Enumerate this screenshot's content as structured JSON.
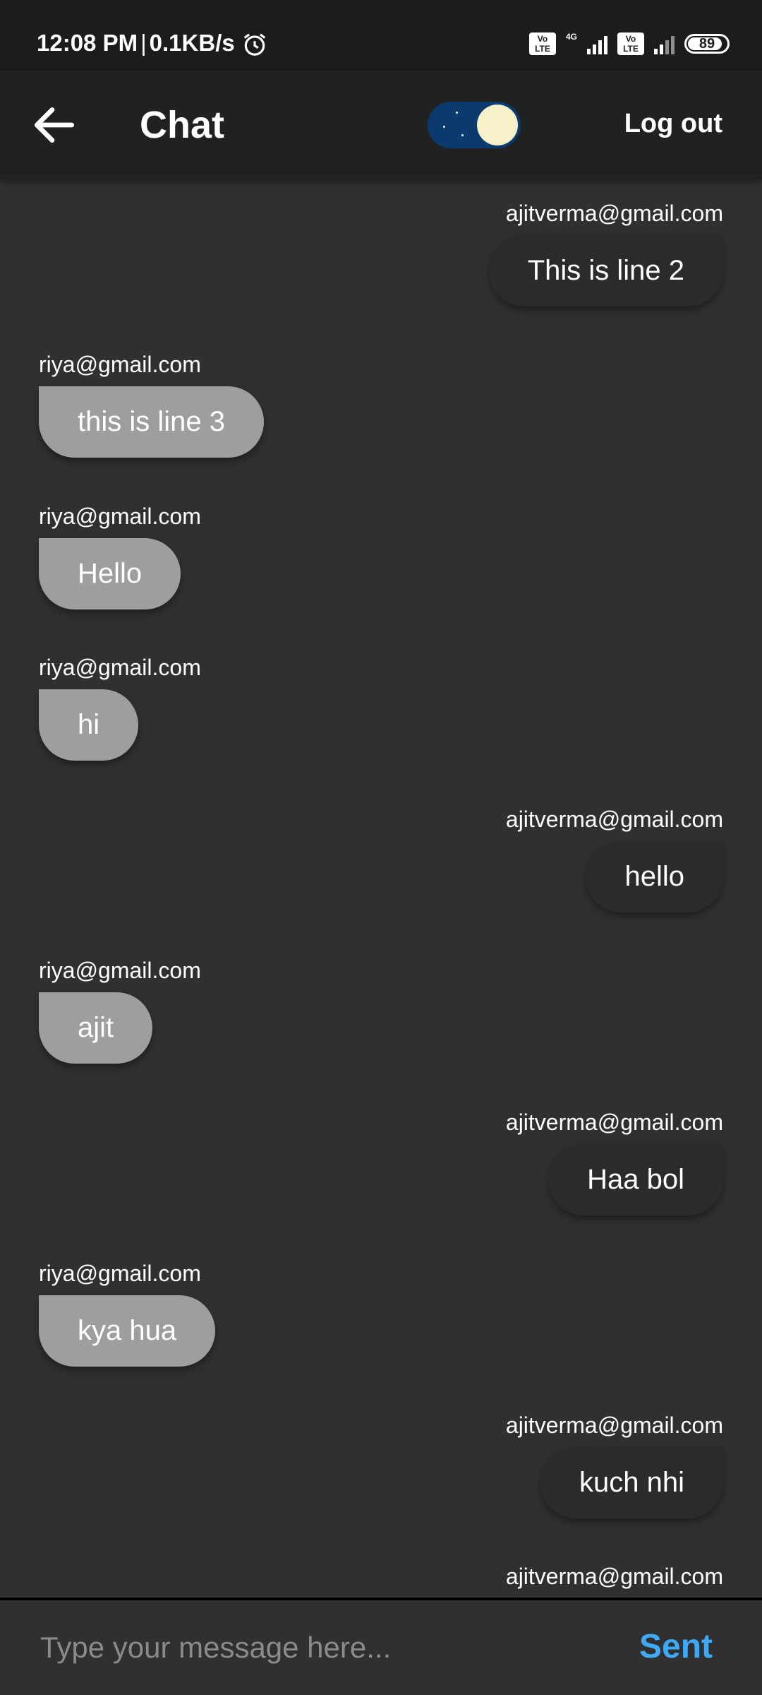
{
  "status_bar": {
    "time": "12:08 PM",
    "separator": "|",
    "speed": "0.1KB/s",
    "net_type": "4G",
    "volte_label": "Vo LTE",
    "battery": "89"
  },
  "app_bar": {
    "title": "Chat",
    "logout_label": "Log out",
    "theme_mode": "dark"
  },
  "messages": [
    {
      "sender": "ajitverma@gmail.com",
      "text": "This is line 2",
      "side": "right"
    },
    {
      "sender": "riya@gmail.com",
      "text": "this is line 3",
      "side": "left"
    },
    {
      "sender": "riya@gmail.com",
      "text": "Hello",
      "side": "left"
    },
    {
      "sender": "riya@gmail.com",
      "text": "hi",
      "side": "left"
    },
    {
      "sender": "ajitverma@gmail.com",
      "text": "hello",
      "side": "right"
    },
    {
      "sender": "riya@gmail.com",
      "text": "ajit",
      "side": "left"
    },
    {
      "sender": "ajitverma@gmail.com",
      "text": "Haa bol",
      "side": "right"
    },
    {
      "sender": "riya@gmail.com",
      "text": "kya hua",
      "side": "left"
    },
    {
      "sender": "ajitverma@gmail.com",
      "text": "kuch nhi",
      "side": "right"
    },
    {
      "sender": "ajitverma@gmail.com",
      "text": "",
      "side": "right"
    }
  ],
  "composer": {
    "placeholder": "Type your message here...",
    "send_label": "Sent"
  },
  "colors": {
    "background": "#303030",
    "app_bar": "#212121",
    "incoming_bubble": "#9e9e9e",
    "outgoing_bubble": "#2b2b2b",
    "accent": "#3fa9f5"
  }
}
